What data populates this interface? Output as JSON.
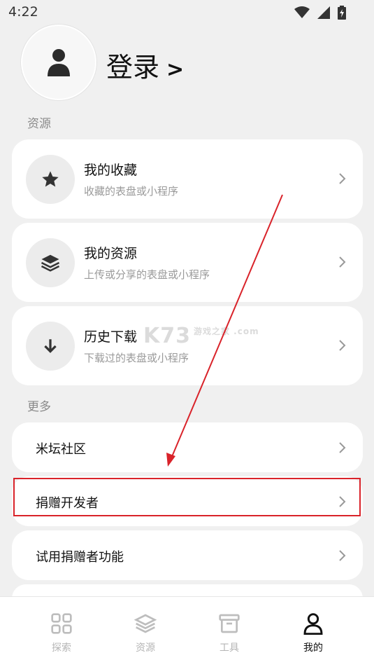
{
  "status": {
    "time": "4:22"
  },
  "profile": {
    "login_label": "登录",
    "login_arrow": ">"
  },
  "sections": {
    "resources": "资源",
    "more": "更多"
  },
  "resource_cards": [
    {
      "title": "我的收藏",
      "subtitle": "收藏的表盘或小程序",
      "icon": "star-icon"
    },
    {
      "title": "我的资源",
      "subtitle": "上传或分享的表盘或小程序",
      "icon": "layers-icon"
    },
    {
      "title": "历史下载",
      "subtitle": "下载过的表盘或小程序",
      "icon": "download-icon"
    }
  ],
  "more_items": [
    {
      "title": "米坛社区"
    },
    {
      "title": "捐赠开发者"
    },
    {
      "title": "试用捐赠者功能"
    }
  ],
  "watermark": {
    "text": "K73",
    "sub": "游戏之家 .com"
  },
  "bottom_nav": [
    {
      "label": "探索",
      "icon": "grid-icon",
      "active": false
    },
    {
      "label": "资源",
      "icon": "layers-icon",
      "active": false
    },
    {
      "label": "工具",
      "icon": "toolbox-icon",
      "active": false
    },
    {
      "label": "我的",
      "icon": "person-icon",
      "active": true
    }
  ],
  "colors": {
    "highlight": "#d9232a",
    "background": "#f0f0f0",
    "card": "#ffffff"
  }
}
